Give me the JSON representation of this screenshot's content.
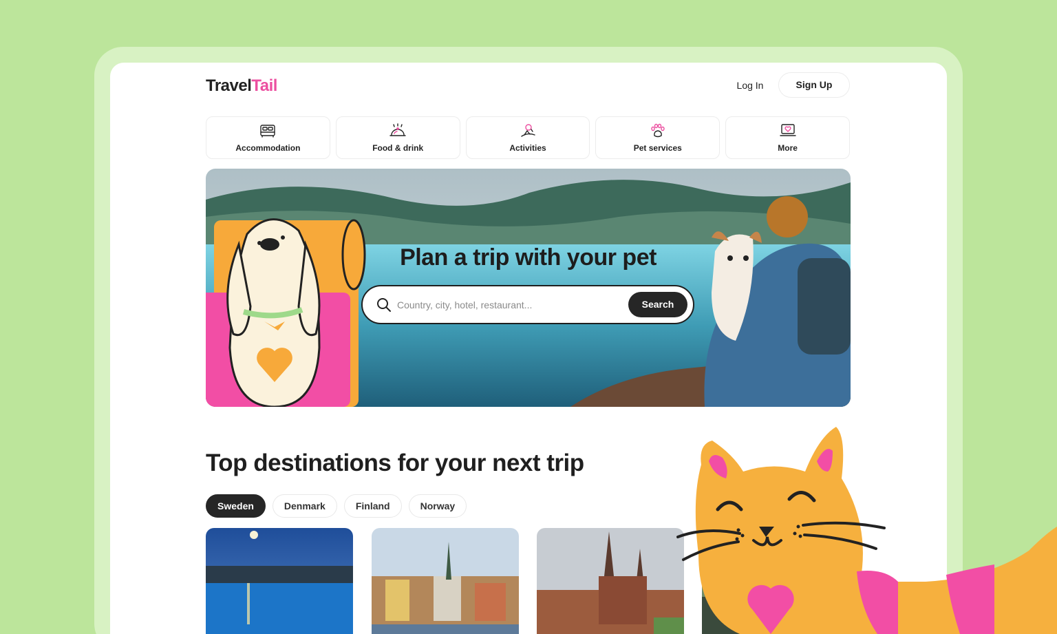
{
  "brand": {
    "logo_part1": "Travel",
    "logo_part2": "Tail",
    "accent": "#ec4fa0",
    "page_bg": "#bce59b"
  },
  "header": {
    "login_label": "Log In",
    "signup_label": "Sign Up"
  },
  "categories": [
    {
      "label": "Accommodation",
      "icon": "bed-icon"
    },
    {
      "label": "Food & drink",
      "icon": "food-cloche-icon"
    },
    {
      "label": "Activities",
      "icon": "activities-icon"
    },
    {
      "label": "Pet services",
      "icon": "paw-icon"
    },
    {
      "label": "More",
      "icon": "laptop-heart-icon"
    }
  ],
  "hero": {
    "title": "Plan a trip with your pet",
    "search_placeholder": "Country, city, hotel, restaurant...",
    "search_button": "Search"
  },
  "destinations": {
    "title": "Top destinations for your next trip",
    "tabs": [
      {
        "label": "Sweden",
        "active": true
      },
      {
        "label": "Denmark",
        "active": false
      },
      {
        "label": "Finland",
        "active": false
      },
      {
        "label": "Norway",
        "active": false
      }
    ]
  }
}
